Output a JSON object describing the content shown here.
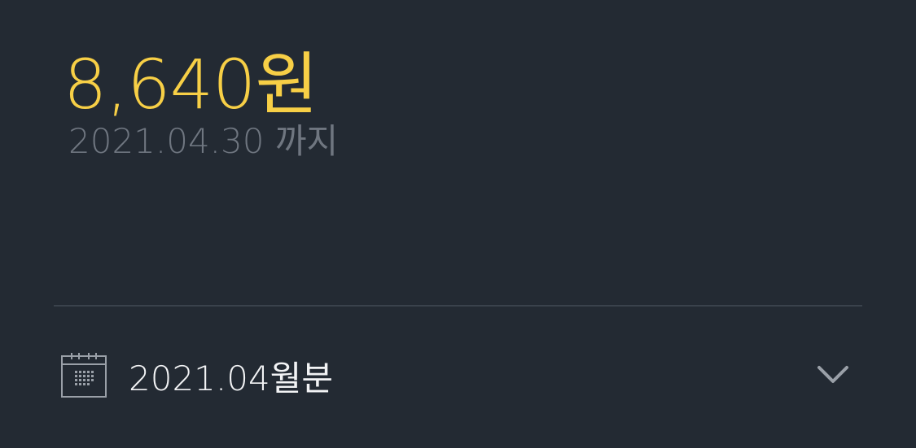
{
  "balance": {
    "amount": "8,640원",
    "due_date": "2021.04.30 까지"
  },
  "period_selector": {
    "label": "2021.04월분",
    "icon": "calendar-icon",
    "dropdown_icon": "chevron-down-icon"
  },
  "colors": {
    "background": "#232a33",
    "amount": "#f7cf46",
    "muted_text": "#6f7680",
    "divider": "#3a424c",
    "primary_text": "#f2f3f5",
    "icon": "#9aa0a8"
  }
}
